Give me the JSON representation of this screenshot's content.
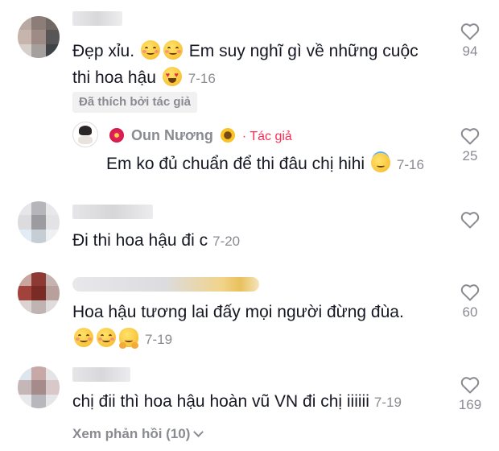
{
  "colors": {
    "text": "#161823",
    "muted": "#8a8b91",
    "author_accent": "#fe2c55"
  },
  "comments": [
    {
      "text_line1": "Đẹp xỉu.",
      "text_line1b": "Em suy nghĩ gì về những cuộc",
      "text_line2": "thi hoa hậu",
      "date": "7-16",
      "likes": "94",
      "liked_by_author": "Đã thích bởi tác giả"
    },
    {
      "author_name": "Oun Nương",
      "author_tag": "· Tác giả",
      "text": "Em ko đủ chuẩn để thi đâu chị hihi",
      "date": "7-16",
      "likes": "25"
    },
    {
      "text": "Đi thi hoa hậu đi c",
      "date": "7-20",
      "likes": ""
    },
    {
      "text_line1": "Hoa hậu tương lai đấy mọi người đừng đùa.",
      "date": "7-19",
      "likes": "60"
    },
    {
      "text": "chị đii thì hoa hậu hoàn vũ VN đi chị iiiiii",
      "date": "7-19",
      "likes": "169"
    }
  ],
  "view_replies": "Xem phản hồi (10)",
  "icons": {
    "like": "heart-outline-icon",
    "expand": "chevron-down-icon"
  }
}
